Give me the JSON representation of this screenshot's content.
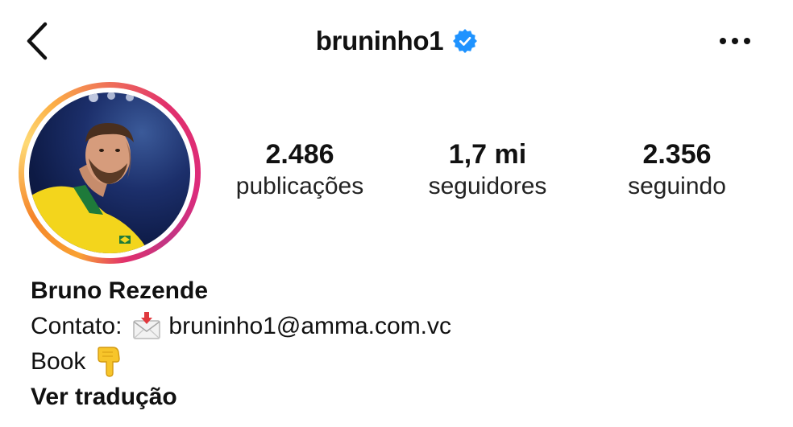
{
  "header": {
    "username": "bruninho1",
    "verified": true,
    "back_icon": "chevron-left-icon",
    "more_icon": "more-horizontal-icon",
    "verified_color": "#1f93ff"
  },
  "profile": {
    "avatar_ring_colors": [
      "#feda75",
      "#fa7e1e",
      "#d62976",
      "#962fbf"
    ]
  },
  "stats": {
    "posts_value": "2.486",
    "posts_label": "publicações",
    "followers_value": "1,7 mi",
    "followers_label": "seguidores",
    "following_value": "2.356",
    "following_label": "seguindo"
  },
  "bio": {
    "name": "Bruno Rezende",
    "contact_label": "Contato:",
    "contact_icon": "envelope-with-arrow-icon",
    "contact_email": "bruninho1@amma.com.vc",
    "book_label": "Book",
    "book_icon": "pointing-down-hand-icon",
    "translate_link": "Ver tradução"
  }
}
